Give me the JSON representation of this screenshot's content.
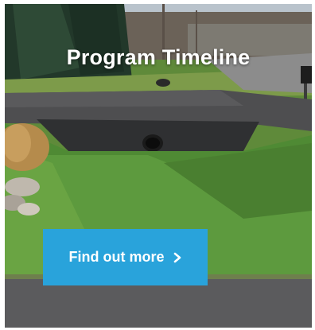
{
  "card": {
    "title": "Program Timeline",
    "button_label": "Find out more",
    "button_icon": "chevron-right-icon",
    "accent_color": "#29a3db"
  }
}
